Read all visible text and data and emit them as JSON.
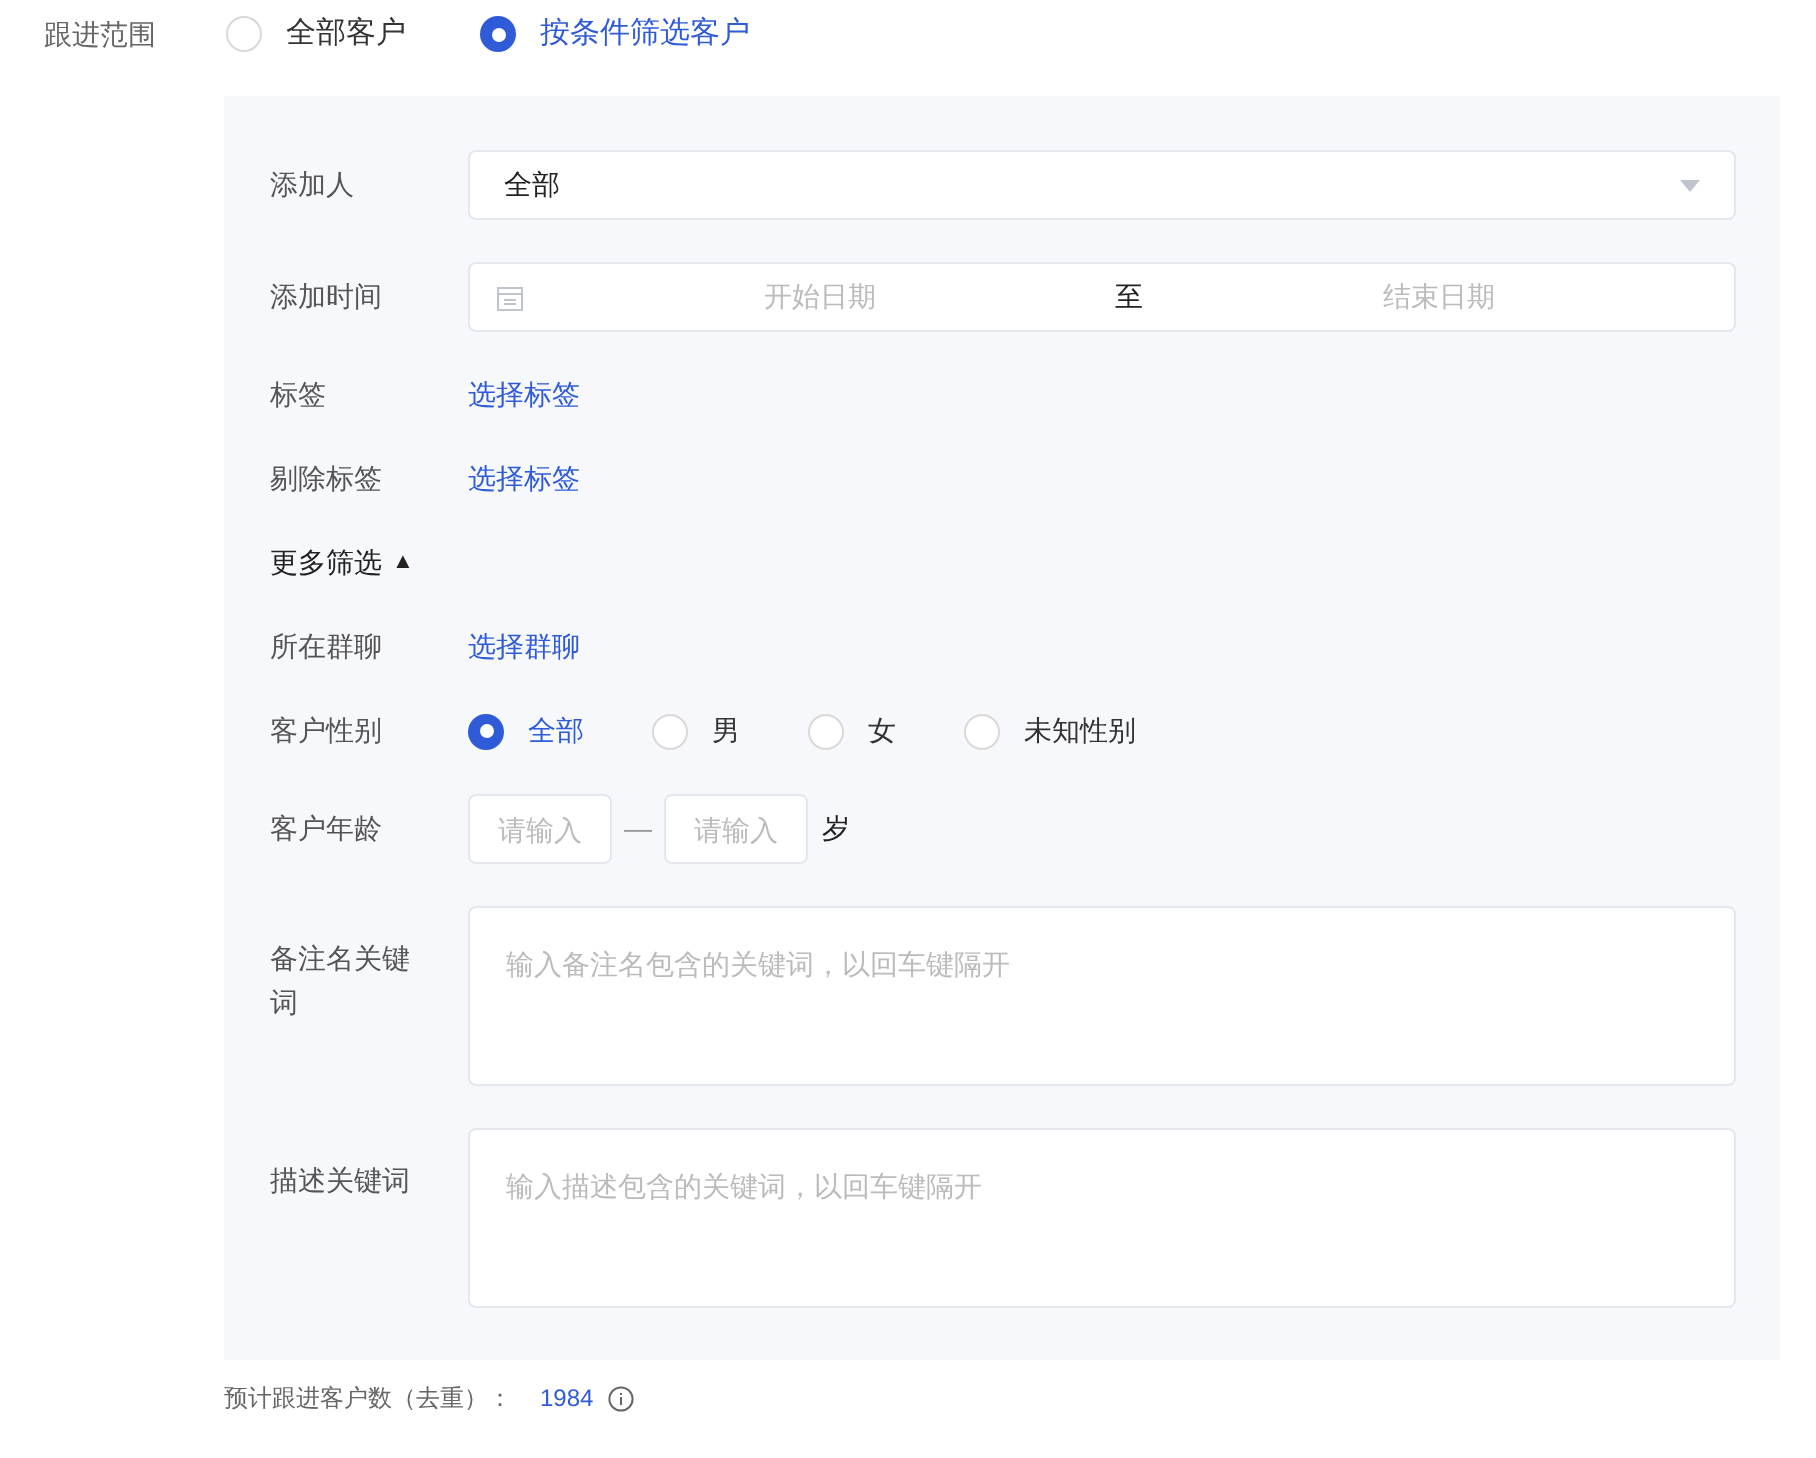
{
  "scope": {
    "label": "跟进范围",
    "options": [
      {
        "label": "全部客户",
        "selected": false
      },
      {
        "label": "按条件筛选客户",
        "selected": true
      }
    ]
  },
  "filters": [
    {
      "kind": "select",
      "label": "添加人",
      "value": "全部"
    },
    {
      "kind": "daterange",
      "label": "添加时间",
      "start_placeholder": "开始日期",
      "separator": "至",
      "end_placeholder": "结束日期"
    },
    {
      "kind": "link",
      "label": "标签",
      "link": "选择标签"
    },
    {
      "kind": "link",
      "label": "剔除标签",
      "link": "选择标签"
    }
  ],
  "more": {
    "label": "更多筛选",
    "icon": "▲",
    "expanded": true
  },
  "more_filters": [
    {
      "kind": "link",
      "label": "所在群聊",
      "link": "选择群聊"
    },
    {
      "kind": "radio",
      "label": "客户性别",
      "options": [
        {
          "label": "全部",
          "selected": true
        },
        {
          "label": "男",
          "selected": false
        },
        {
          "label": "女",
          "selected": false
        },
        {
          "label": "未知性别",
          "selected": false
        }
      ]
    },
    {
      "kind": "range",
      "label": "客户年龄",
      "min_placeholder": "请输入",
      "separator": "—",
      "max_placeholder": "请输入",
      "unit": "岁"
    },
    {
      "kind": "textarea",
      "label": "备注名关键词",
      "placeholder": "输入备注名包含的关键词，以回车键隔开"
    },
    {
      "kind": "textarea",
      "label": "描述关键词",
      "placeholder": "输入描述包含的关键词，以回车键隔开"
    }
  ],
  "footer": {
    "label": "预计跟进客户数（去重）：",
    "count": "1984"
  }
}
